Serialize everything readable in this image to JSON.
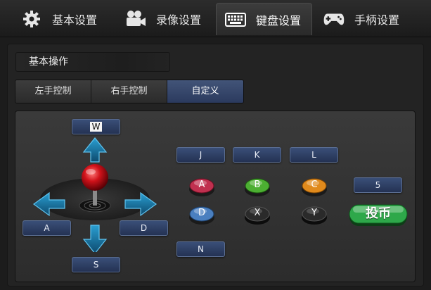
{
  "tabs": [
    {
      "label": "基本设置",
      "icon": "gear-icon"
    },
    {
      "label": "录像设置",
      "icon": "video-camera-icon"
    },
    {
      "label": "键盘设置",
      "icon": "keyboard-icon",
      "active": true
    },
    {
      "label": "手柄设置",
      "icon": "gamepad-icon"
    }
  ],
  "section": {
    "title": "基本操作"
  },
  "subtabs": [
    {
      "label": "左手控制"
    },
    {
      "label": "右手控制"
    },
    {
      "label": "自定义",
      "active": true
    }
  ],
  "joystick": {
    "up_key": "W",
    "left_key": "A",
    "down_key": "S",
    "right_key": "D"
  },
  "buttons": [
    {
      "name": "A",
      "key": "J",
      "color": "#c0304f"
    },
    {
      "name": "B",
      "key": "K",
      "color": "#4caf32"
    },
    {
      "name": "C",
      "key": "L",
      "color": "#e08a1c"
    },
    {
      "name": "D",
      "key": "",
      "color": "#4a7fbf"
    },
    {
      "name": "X",
      "key": "",
      "color": "#2a2a2a"
    },
    {
      "name": "Y",
      "key": "",
      "color": "#2a2a2a"
    },
    {
      "name": "extra",
      "key": "N"
    }
  ],
  "coin": {
    "label": "投币",
    "key": "5",
    "color": "#2ea84a"
  },
  "colors": {
    "accent": "#3a4f78",
    "active_subtab": "#425478",
    "joystick_ball": "#d0121a",
    "arrow": "#1f7fb0"
  }
}
